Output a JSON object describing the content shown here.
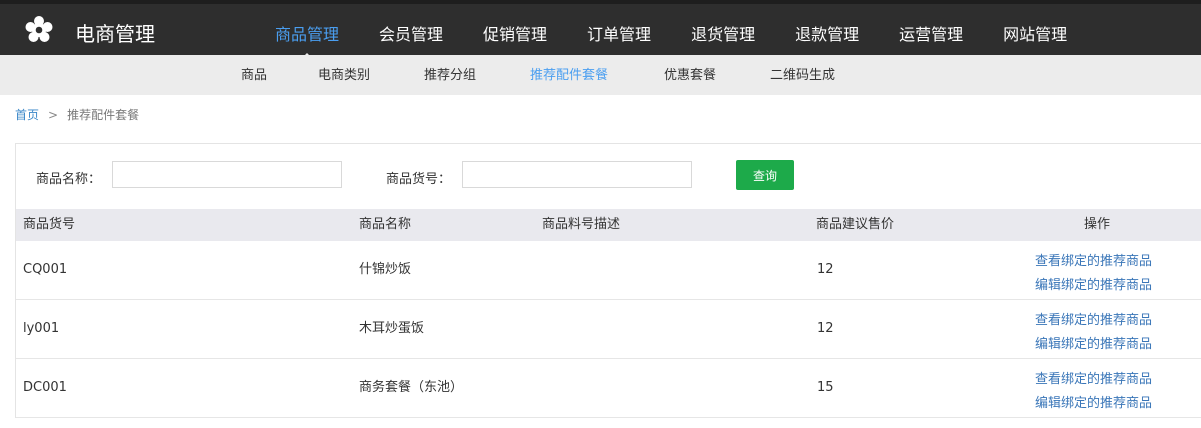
{
  "header": {
    "brand": "电商管理",
    "logo_icon": "flower-logo-icon",
    "nav": [
      {
        "label": "商品管理",
        "active": true
      },
      {
        "label": "会员管理",
        "active": false
      },
      {
        "label": "促销管理",
        "active": false
      },
      {
        "label": "订单管理",
        "active": false
      },
      {
        "label": "退货管理",
        "active": false
      },
      {
        "label": "退款管理",
        "active": false
      },
      {
        "label": "运营管理",
        "active": false
      },
      {
        "label": "网站管理",
        "active": false
      }
    ]
  },
  "subnav": [
    {
      "label": "商品",
      "active": false
    },
    {
      "label": "电商类别",
      "active": false
    },
    {
      "label": "推荐分组",
      "active": false
    },
    {
      "label": "推荐配件套餐",
      "active": true
    },
    {
      "label": "优惠套餐",
      "active": false
    },
    {
      "label": "二维码生成",
      "active": false
    }
  ],
  "breadcrumb": {
    "home": "首页",
    "sep": ">",
    "current": "推荐配件套餐"
  },
  "search": {
    "name_label": "商品名称：",
    "name_value": "",
    "code_label": "商品货号：",
    "code_value": "",
    "button_label": "查询"
  },
  "table": {
    "headers": {
      "code": "商品货号",
      "name": "商品名称",
      "desc": "商品料号描述",
      "price": "商品建议售价",
      "ops": "操作"
    },
    "rows": [
      {
        "code": "CQ001",
        "name": "什锦炒饭",
        "desc": "",
        "price": "12",
        "view": "查看绑定的推荐商品",
        "edit": "编辑绑定的推荐商品"
      },
      {
        "code": "ly001",
        "name": "木耳炒蛋饭",
        "desc": "",
        "price": "12",
        "view": "查看绑定的推荐商品",
        "edit": "编辑绑定的推荐商品"
      },
      {
        "code": "DC001",
        "name": "商务套餐（东池）",
        "desc": "",
        "price": "15",
        "view": "查看绑定的推荐商品",
        "edit": "编辑绑定的推荐商品"
      }
    ]
  },
  "colors": {
    "topbar": "#2e2e2e",
    "active": "#4a9ef0",
    "subnav": "#ececec",
    "button": "#1daa4a",
    "link": "#3a76b8"
  }
}
